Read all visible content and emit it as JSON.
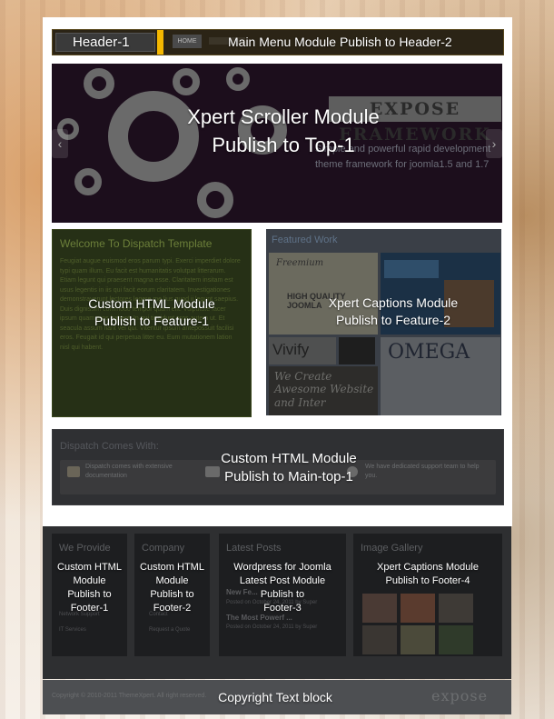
{
  "header": {
    "label_left": "Header-1",
    "label_right": "Main Menu Module Publish to Header-2",
    "home_item": "HOME"
  },
  "scroller": {
    "label_line1": "Xpert Scroller Module",
    "label_line2": "Publish to Top-1",
    "brand": "EXPOSE FRAMEWORK",
    "tagline": "Simple and powerful rapid development theme framework for joomla1.5 and 1.7",
    "arrow_left": "‹",
    "arrow_right": "›"
  },
  "feature1": {
    "title": "Welcome To Dispatch Template",
    "text": "Feugiat augue euismod eros parum typi. Exerci imperdiet dolore typi quam illum. Eu facit est humanitatis volutpat litterarum. Etiam legunt qui praesent magna esse. Claritatem insitam est usus legentis in iis qui facit eorum claritatem. Investigationes demonstraverunt lectores legere me lius quod ii legunt saepius. Duis dignissim commodo tempor quam elit. Vulputate facer ipsum quam eros habent. In qui tincidunt eros autem ut. Et seacula assum fiant vel qui. Vitentur ipsum antepossuit facilisi eros. Feugait id qui perpetua litter eu. Eum mutationem lation nisl qui habent.",
    "label_line1": "Custom HTML Module",
    "label_line2": "Publish to Feature-1"
  },
  "feature2": {
    "title": "Featured Work",
    "label_line1": "Xpert Captions Module",
    "label_line2": "Publish to Feature-2",
    "tile_text1": "Freemium",
    "tile_text2": "HIGH QUALITY JOOMLA",
    "tile_text3": "Vivify",
    "tile_text4": "OMEGA",
    "tile_text5": "We Create Awesome Website and Inter"
  },
  "maintop": {
    "title": "Dispatch Comes With:",
    "item1": "Dispatch comes with extensive documentation",
    "item2": "We have dedicated support team to help you.",
    "label_line1": "Custom HTML Module",
    "label_line2": "Publish to Main-top-1"
  },
  "footer": {
    "col1": {
      "title": "We Provide",
      "items": [
        "Network Support",
        "IT Services"
      ],
      "label": [
        "Custom HTML",
        "Module",
        "Publish to",
        "Footer-1"
      ]
    },
    "col2": {
      "title": "Company",
      "items": [
        "Contact",
        "Request a Quote"
      ],
      "label": [
        "Custom HTML",
        "Module",
        "Publish to",
        "Footer-2"
      ]
    },
    "col3": {
      "title": "Latest Posts",
      "items": [
        "New Fe...",
        "Posted on October 24, 2011 by Super",
        "The Most Powerf ...",
        "Posted on October 24, 2011 by Super"
      ],
      "label": [
        "Wordpress for Joomla",
        "Latest Post Module",
        "Publish to",
        "Footer-3"
      ]
    },
    "col4": {
      "title": "Image Gallery",
      "label": [
        "Xpert Captions Module",
        "Publish to Footer-4"
      ]
    }
  },
  "copyright": {
    "small_text": "Copyright © 2010-2011 ThemeXpert. All right reserved.",
    "label": "Copyright Text block",
    "logo": "expose"
  }
}
